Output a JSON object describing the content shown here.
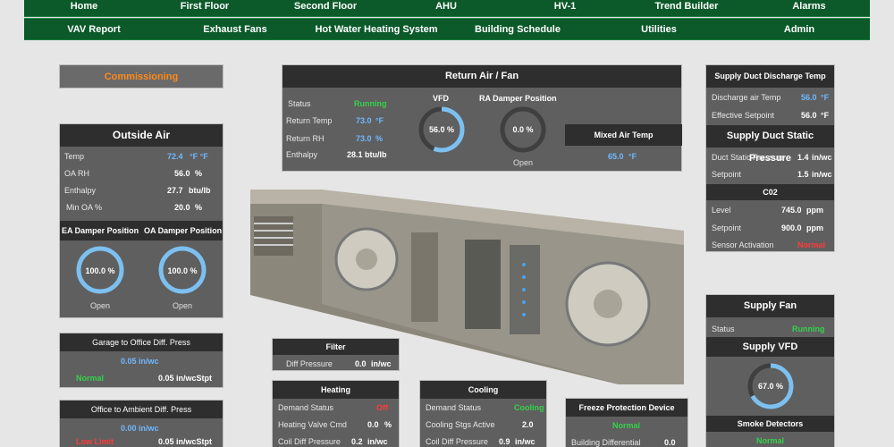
{
  "nav": {
    "row1": [
      "Home",
      "First Floor",
      "Second Floor",
      "AHU",
      "HV-1",
      "Trend Builder",
      "Alarms"
    ],
    "row2": [
      "VAV Report",
      "Exhaust Fans",
      "Hot Water Heating System",
      "Building Schedule",
      "Utilities",
      "Admin"
    ]
  },
  "commissioning": {
    "label": "Commissioning"
  },
  "outside_air": {
    "title": "Outside Air",
    "temp_label": "Temp",
    "temp_value": "72.4",
    "temp_unit": "°F  °F",
    "rh_label": "OA RH",
    "rh_value": "56.0",
    "rh_unit": "%",
    "enthalpy_label": "Enthalpy",
    "enthalpy_value": "27.7",
    "enthalpy_unit": "btu/lb",
    "min_oa_label": "Min OA %",
    "min_oa_value": "20.0",
    "min_oa_unit": "%",
    "ea_damper_label": "EA Damper Position",
    "ea_damper_value": "100.0  %",
    "ea_damper_fraction": 1.0,
    "ea_damper_state": "Open",
    "oa_damper_label": "OA Damper Position",
    "oa_damper_value": "100.0  %",
    "oa_damper_fraction": 1.0,
    "oa_damper_state": "Open"
  },
  "return_air": {
    "title": "Return Air / Fan",
    "status_label": "Status",
    "status_value": "Running",
    "temp_label": "Return Temp",
    "temp_value": "73.0",
    "temp_unit": "°F",
    "rh_label": "Return RH",
    "rh_value": "73.0",
    "rh_unit": "%",
    "enthalpy_label": "Enthalpy",
    "enthalpy_value": "28.1 btu/lb",
    "vfd_label": "VFD",
    "vfd_value": "56.0  %",
    "vfd_fraction": 0.56,
    "ra_damper_label": "RA  Damper  Position",
    "ra_damper_value": "0.0  %",
    "ra_damper_fraction": 0.0,
    "ra_damper_state": "Open",
    "mixed_air_label": "Mixed Air Temp",
    "mixed_air_value": "65.0",
    "mixed_air_unit": "°F"
  },
  "supply_discharge": {
    "title": "Supply Duct Discharge Temp",
    "discharge_label": "Discharge air Temp",
    "discharge_value": "56.0",
    "discharge_unit": "°F",
    "setpoint_label": "Effective Setpoint",
    "setpoint_value": "56.0",
    "setpoint_unit": "°F"
  },
  "static_pressure": {
    "title": "Supply Duct Static Pressure",
    "pressure_label": "Duct Static Pressure",
    "pressure_value": "1.4",
    "pressure_unit": "in/wc",
    "setpoint_label": "Setpoint",
    "setpoint_value": "1.5",
    "setpoint_unit": "in/wc"
  },
  "co2": {
    "title": "C02",
    "level_label": "Level",
    "level_value": "745.0",
    "level_unit": "ppm",
    "setpoint_label": "Setpoint",
    "setpoint_value": "900.0",
    "setpoint_unit": "ppm",
    "activation_label": "Sensor Activation",
    "activation_value": "Normal"
  },
  "supply_fan": {
    "title": "Supply Fan",
    "status_label": "Status",
    "status_value": "Running",
    "vfd_title": "Supply  VFD",
    "vfd_value": "67.0  %",
    "vfd_fraction": 0.67,
    "smoke_title": "Smoke Detectors",
    "smoke_value": "Normal"
  },
  "garage_press": {
    "title": "Garage to Office Diff. Press",
    "value": "0.05  in/wc",
    "status": "Normal",
    "setpoint": "0.05  in/wcStpt"
  },
  "ambient_press": {
    "title": "Office to Ambient Diff. Press",
    "value": "0.00  in/wc",
    "status": "Low  Limit",
    "setpoint": "0.05  in/wcStpt"
  },
  "filter": {
    "title": "Filter",
    "label": "Diff Pressure",
    "value": "0.0",
    "unit": "in/wc"
  },
  "heating": {
    "title": "Heating",
    "demand_label": "Demand Status",
    "demand_value": "Off",
    "valve_label": "Heating Valve Cmd",
    "valve_value": "0.0",
    "valve_unit": "%",
    "coil_label": "Coil Diff Pressure",
    "coil_value": "0.2",
    "coil_unit": "in/wc"
  },
  "cooling": {
    "title": "Cooling",
    "demand_label": "Demand Status",
    "demand_value": "Cooling",
    "stages_label": "Cooling Stgs Active",
    "stages_value": "2.0",
    "coil_label": "Coil Diff Pressure",
    "coil_value": "0.9",
    "coil_unit": "in/wc"
  },
  "freeze": {
    "title": "Freeze Protection Device",
    "status": "Normal",
    "diff_label": "Building Differential",
    "diff_value": "0.0"
  },
  "colors": {
    "nav": "#0c5a2a",
    "panel": "#5f5f5f",
    "header": "#2e2e2e",
    "ring": "#7dc0f0",
    "ok": "#34d24a",
    "alarm": "#ff3b3b",
    "accent": "#ff8a1a"
  }
}
